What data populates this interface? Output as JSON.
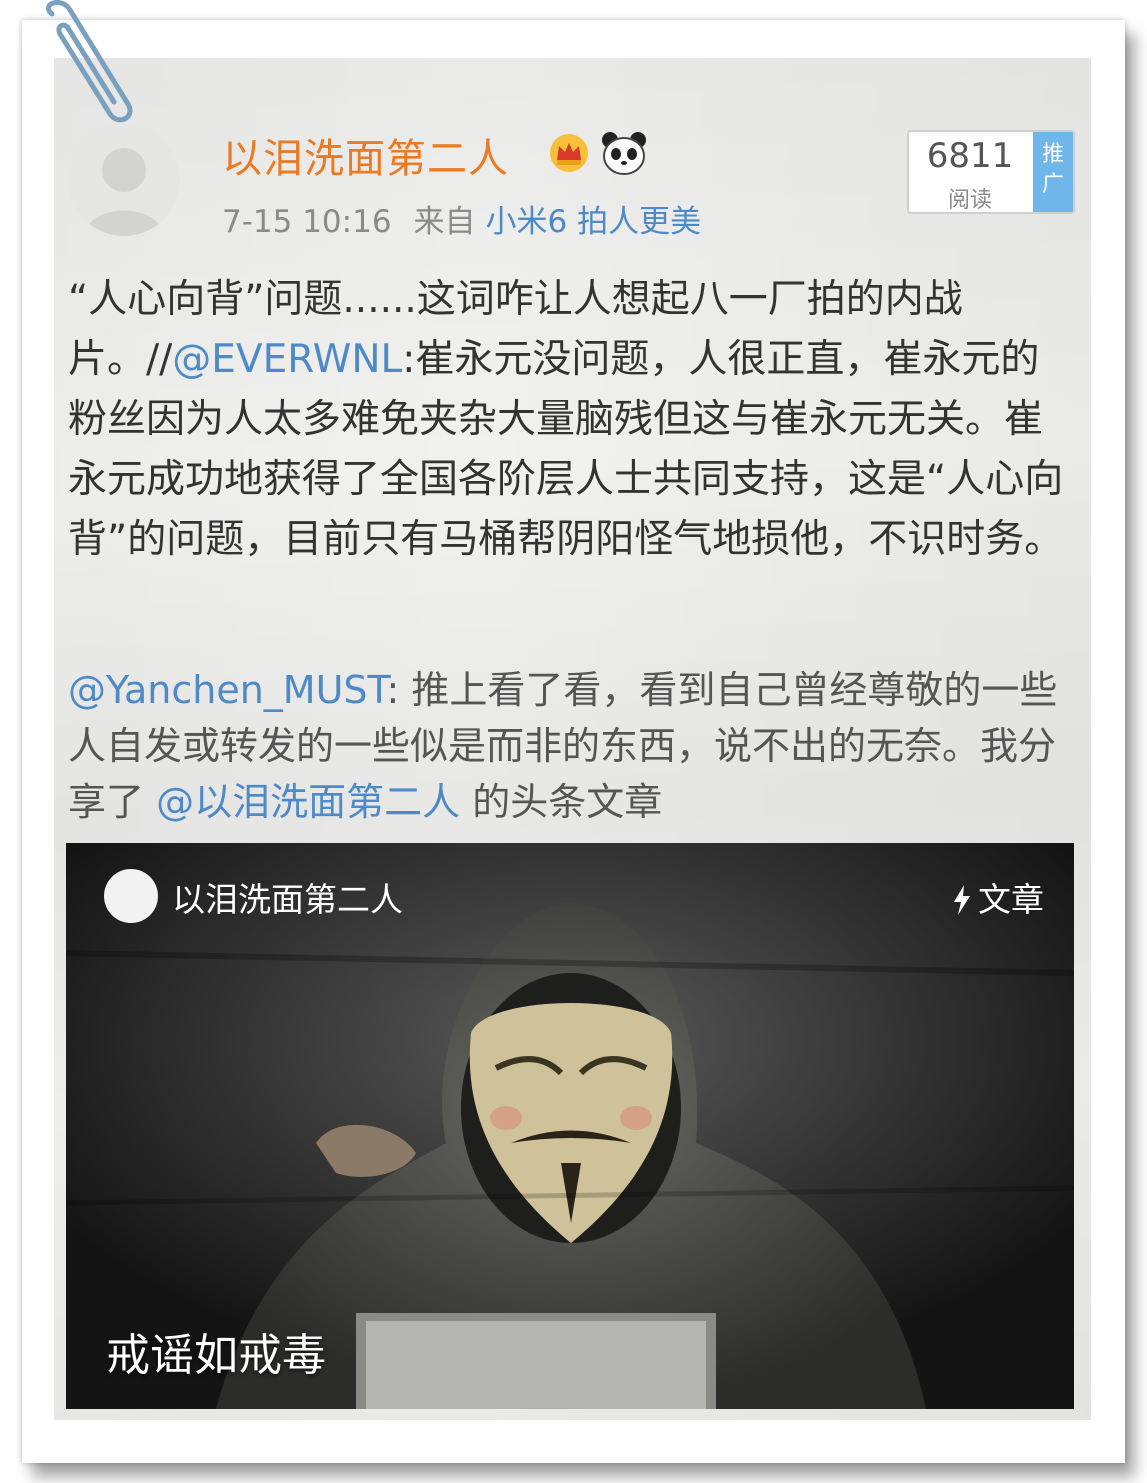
{
  "post": {
    "username": "以泪洗面第二人",
    "time": "7-15 10:16",
    "from_label": "来自",
    "source": "小米6 拍人更美",
    "read_count": "6811",
    "read_label": "阅读",
    "promote_label": "推广",
    "text_part1": "“人心向背”问题......这词咋让人想起八一厂拍的内战片。//",
    "mention1": "@EVERWNL",
    "text_part2": ":崔永元没问题，人很正直，崔永元的粉丝因为人太多难免夹杂大量脑残但这与崔永元无关。崔永元成功地获得了全国各阶层人士共同支持，这是“人心向背”的问题，目前只有马桶帮阴阳怪气地损他，不识时务。"
  },
  "repost": {
    "mention": "@Yanchen_MUST",
    "text_part1": ": 推上看了看，看到自己曾经尊敬的一些人自发或转发的一些似是而非的东西，说不出的无奈。我分享了 ",
    "mention2": "@以泪洗面第二人",
    "text_part2": " 的头条文章"
  },
  "card": {
    "author": "以泪洗面第二人",
    "type_label": "文章",
    "title": "戒谣如戒毒"
  },
  "icons": {
    "avatar": "default-avatar-icon",
    "crown": "crown-badge-icon",
    "panda": "panda-badge-icon",
    "clip": "paperclip-icon",
    "bolt": "lightning-icon"
  },
  "colors": {
    "username": "#ec7a22",
    "link": "#4e8ac8",
    "promo": "#6fb6ea"
  }
}
